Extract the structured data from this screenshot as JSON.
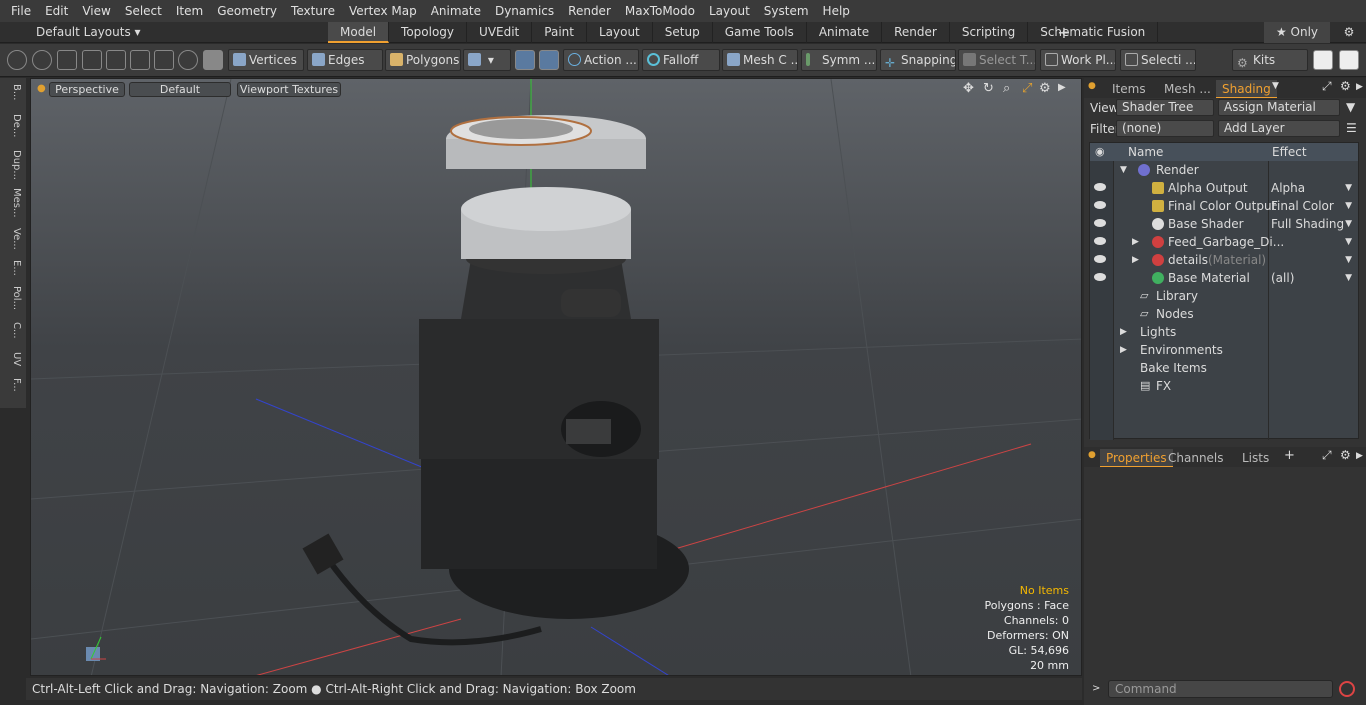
{
  "menu": [
    "File",
    "Edit",
    "View",
    "Select",
    "Item",
    "Geometry",
    "Texture",
    "Vertex Map",
    "Animate",
    "Dynamics",
    "Render",
    "MaxToModo",
    "Layout",
    "System",
    "Help"
  ],
  "layouts": {
    "selector": "Default Layouts ▾",
    "tabs": [
      "Model",
      "Topology",
      "UVEdit",
      "Paint",
      "Layout",
      "Setup",
      "Game Tools",
      "Animate",
      "Render",
      "Scripting",
      "Schematic Fusion"
    ],
    "active": "Model",
    "only": "★ Only"
  },
  "toolbar": {
    "vertices": "Vertices",
    "edges": "Edges",
    "polygons": "Polygons",
    "action": "Action ...",
    "falloff": "Falloff",
    "mesh": "Mesh C ...",
    "symm": "Symm ...",
    "snapping": "Snapping",
    "select_t": "Select T...",
    "work": "Work Pl...",
    "selecti": "Selecti ...",
    "kits": "Kits"
  },
  "left_strip": [
    "B...",
    "De...",
    "Dup...",
    "Mes...",
    "Ve...",
    "E...",
    "Pol...",
    "C...",
    "UV",
    "F..."
  ],
  "viewport": {
    "perspective": "Perspective",
    "default": "Default",
    "textures": "Viewport Textures"
  },
  "stats": {
    "items": "No Items",
    "polygons": "Polygons : Face",
    "channels": "Channels: 0",
    "deformers": "Deformers: ON",
    "gl": "GL: 54,696",
    "size": "20 mm"
  },
  "status": "Ctrl-Alt-Left Click and Drag: Navigation: Zoom ● Ctrl-Alt-Right Click and Drag: Navigation: Box Zoom",
  "right": {
    "tabs": [
      "Items",
      "Mesh ...",
      "Shading"
    ],
    "view_label": "View",
    "view_value": "Shader Tree",
    "assign": "Assign Material",
    "filter_label": "Filter",
    "filter_value": "(none)",
    "add_layer": "Add Layer",
    "col_name": "Name",
    "col_effect": "Effect",
    "rows": [
      {
        "name": "Render",
        "effect": ""
      },
      {
        "name": "Alpha Output",
        "effect": "Alpha"
      },
      {
        "name": "Final Color Output",
        "effect": "Final Color"
      },
      {
        "name": "Base Shader",
        "effect": "Full Shading"
      },
      {
        "name": "Feed_Garbage_Di...",
        "effect": ""
      },
      {
        "name": "details",
        "sub": "(Material)",
        "effect": ""
      },
      {
        "name": "Base Material",
        "effect": "(all)"
      },
      {
        "name": "Library",
        "effect": ""
      },
      {
        "name": "Nodes",
        "effect": ""
      },
      {
        "name": "Lights",
        "effect": ""
      },
      {
        "name": "Environments",
        "effect": ""
      },
      {
        "name": "Bake Items",
        "effect": ""
      },
      {
        "name": "FX",
        "effect": ""
      }
    ],
    "ptabs": [
      "Properties",
      "Channels",
      "Lists"
    ],
    "command": "Command"
  }
}
